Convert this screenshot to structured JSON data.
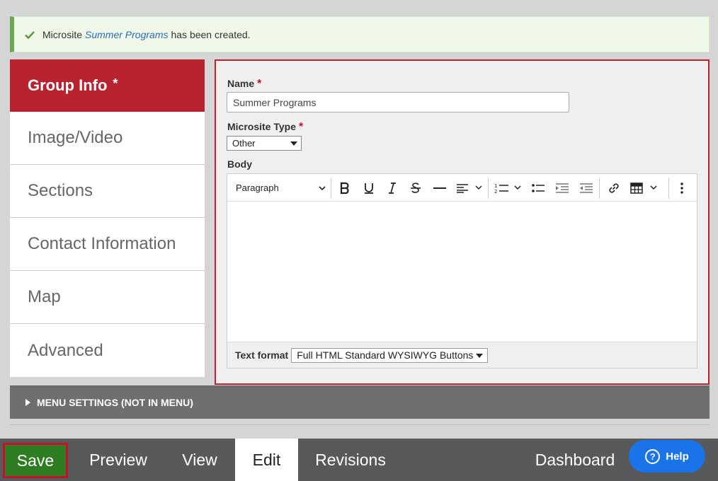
{
  "status": {
    "prefix": "Microsite",
    "link": "Summer Programs",
    "suffix": "has been created."
  },
  "tabs": [
    {
      "label": "Group Info",
      "star": "*"
    },
    {
      "label": "Image/Video"
    },
    {
      "label": "Sections"
    },
    {
      "label": "Contact Information"
    },
    {
      "label": "Map"
    },
    {
      "label": "Advanced"
    }
  ],
  "form": {
    "name_label": "Name",
    "name_value": "Summer Programs",
    "type_label": "Microsite Type",
    "type_value": "Other",
    "required_mark": "*",
    "body_label": "Body",
    "paragraph": "Paragraph",
    "text_format_label": "Text format",
    "text_format_value": "Full HTML Standard WYSIWYG Buttons"
  },
  "menu_settings": "MENU SETTINGS (NOT IN MENU)",
  "bottom": {
    "save": "Save",
    "preview": "Preview",
    "view": "View",
    "edit": "Edit",
    "revisions": "Revisions",
    "dashboard": "Dashboard",
    "help": "Help",
    "help_icon": "?"
  },
  "colors": {
    "accent_red": "#b8232f",
    "success_green": "#6aa84f",
    "save_green": "#2e7d22",
    "help_blue": "#1a73e8"
  }
}
